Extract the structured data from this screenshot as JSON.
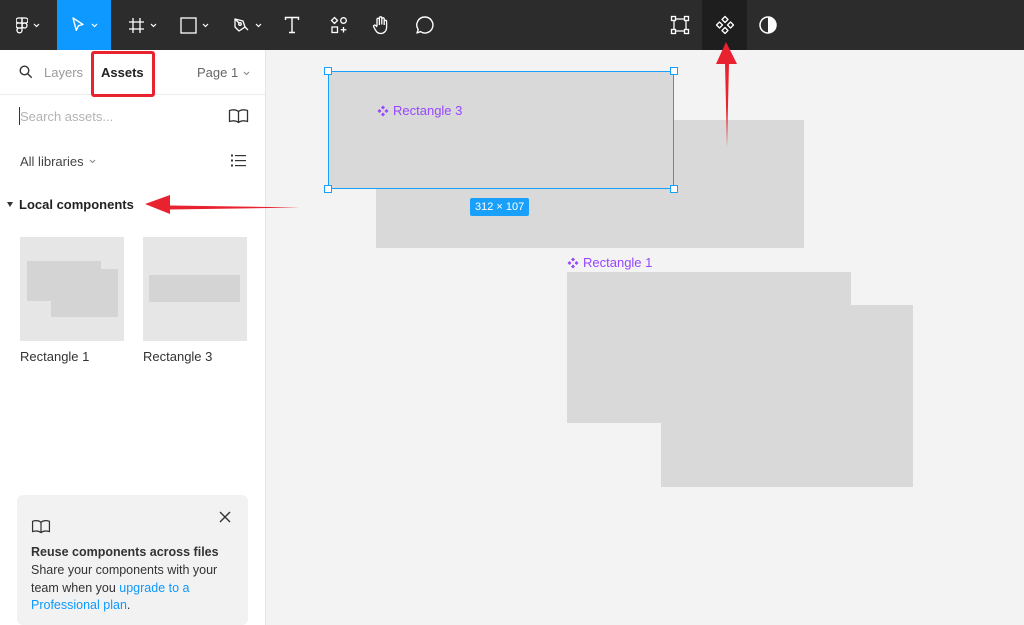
{
  "toolbar": {
    "tools": [
      {
        "name": "figma-menu",
        "icon": "figma-logo-icon",
        "has_dropdown": true
      },
      {
        "name": "move",
        "icon": "move-cursor-icon",
        "has_dropdown": true,
        "active": true
      },
      {
        "name": "frame",
        "icon": "frame-hash-icon",
        "has_dropdown": true
      },
      {
        "name": "shape",
        "icon": "rectangle-icon",
        "has_dropdown": true
      },
      {
        "name": "pen",
        "icon": "pen-icon",
        "has_dropdown": true
      },
      {
        "name": "text",
        "icon": "text-icon"
      },
      {
        "name": "resources",
        "icon": "resources-icon"
      },
      {
        "name": "hand",
        "icon": "hand-icon"
      },
      {
        "name": "comment",
        "icon": "comment-icon"
      },
      {
        "name": "edit-object",
        "icon": "edit-object-icon"
      },
      {
        "name": "create-component",
        "icon": "component-icon",
        "active": true
      },
      {
        "name": "mask",
        "icon": "contrast-icon"
      }
    ],
    "accent_color": "#0d99ff"
  },
  "panel": {
    "tabs": {
      "layers": "Layers",
      "assets": "Assets",
      "active": "Assets"
    },
    "page_selector": "Page 1",
    "search": {
      "placeholder": "Search assets...",
      "value": ""
    },
    "libraries_dropdown": "All libraries",
    "section_title": "Local components",
    "components": [
      {
        "label": "Rectangle 1"
      },
      {
        "label": "Rectangle 3"
      }
    ],
    "info_card": {
      "title": "Reuse components across files",
      "body_text": "Share your components with your team when you",
      "link_text": "upgrade to a Professional plan",
      "body_end": "."
    }
  },
  "canvas": {
    "component_labels": {
      "rect3": "Rectangle 3",
      "rect1": "Rectangle 1"
    },
    "selection_dimensions": "312 × 107",
    "component_color": "#9747ff",
    "selection_color": "#18a0fb"
  },
  "annotations": {
    "highlight_color": "#e8222e"
  }
}
